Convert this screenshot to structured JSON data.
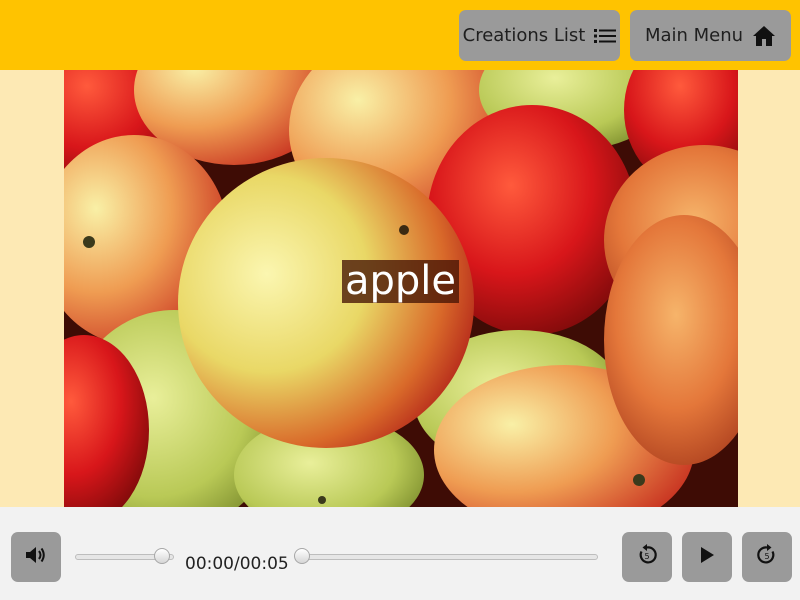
{
  "header": {
    "creations_label": "Creations List",
    "creations_icon": "list-icon",
    "menu_label": "Main Menu",
    "menu_icon": "home-icon",
    "background_color": "#ffc300"
  },
  "content": {
    "image_subject": "apples",
    "caption": "apple"
  },
  "player": {
    "current_time": "00:00",
    "duration": "00:05",
    "time_display": "00:00/00:05",
    "volume_level": 0.9,
    "seek_progress": 0,
    "volume_icon": "speaker-icon",
    "rewind_icon": "rewind-5-icon",
    "play_icon": "play-icon",
    "forward_icon": "forward-5-icon",
    "rewind_seconds": "5",
    "forward_seconds": "5"
  }
}
